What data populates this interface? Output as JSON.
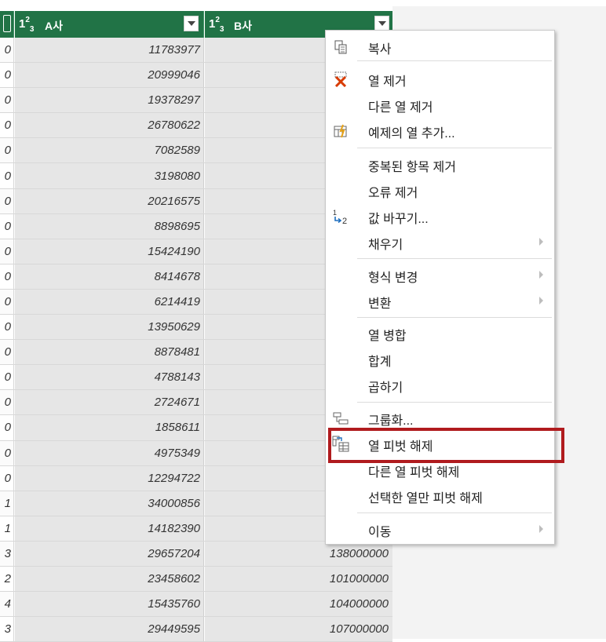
{
  "grid": {
    "columns": [
      {
        "type_label": "1²₃",
        "name": "A사"
      },
      {
        "type_label": "1²₃",
        "name": "B사"
      }
    ],
    "rows": [
      {
        "left": "0",
        "a": "11783977",
        "b": ""
      },
      {
        "left": "0",
        "a": "20999046",
        "b": ""
      },
      {
        "left": "0",
        "a": "19378297",
        "b": ""
      },
      {
        "left": "0",
        "a": "26780622",
        "b": ""
      },
      {
        "left": "0",
        "a": "7082589",
        "b": ""
      },
      {
        "left": "0",
        "a": "3198080",
        "b": ""
      },
      {
        "left": "0",
        "a": "20216575",
        "b": ""
      },
      {
        "left": "0",
        "a": "8898695",
        "b": ""
      },
      {
        "left": "0",
        "a": "15424190",
        "b": ""
      },
      {
        "left": "0",
        "a": "8414678",
        "b": ""
      },
      {
        "left": "0",
        "a": "6214419",
        "b": ""
      },
      {
        "left": "0",
        "a": "13950629",
        "b": ""
      },
      {
        "left": "0",
        "a": "8878481",
        "b": ""
      },
      {
        "left": "0",
        "a": "4788143",
        "b": ""
      },
      {
        "left": "0",
        "a": "2724671",
        "b": ""
      },
      {
        "left": "0",
        "a": "1858611",
        "b": ""
      },
      {
        "left": "0",
        "a": "4975349",
        "b": ""
      },
      {
        "left": "0",
        "a": "12294722",
        "b": ""
      },
      {
        "left": "1",
        "a": "34000856",
        "b": ""
      },
      {
        "left": "1",
        "a": "14182390",
        "b": ""
      },
      {
        "left": "3",
        "a": "29657204",
        "b": "138000000"
      },
      {
        "left": "2",
        "a": "23458602",
        "b": "101000000"
      },
      {
        "left": "4",
        "a": "15435760",
        "b": "104000000"
      },
      {
        "left": "3",
        "a": "29449595",
        "b": "107000000"
      }
    ]
  },
  "menu": {
    "items": [
      {
        "label": "복사",
        "icon": "copy-icon"
      },
      {
        "label": "열 제거",
        "icon": "remove-column-icon"
      },
      {
        "label": "다른 열 제거",
        "icon": ""
      },
      {
        "label": "예제의 열 추가...",
        "icon": "column-from-examples-icon"
      },
      {
        "label": "중복된 항목 제거",
        "icon": ""
      },
      {
        "label": "오류 제거",
        "icon": ""
      },
      {
        "label": "값 바꾸기...",
        "icon": "replace-values-icon"
      },
      {
        "label": "채우기",
        "icon": ""
      },
      {
        "label": "형식 변경",
        "icon": ""
      },
      {
        "label": "변환",
        "icon": ""
      },
      {
        "label": "열 병합",
        "icon": ""
      },
      {
        "label": "합계",
        "icon": ""
      },
      {
        "label": "곱하기",
        "icon": ""
      },
      {
        "label": "그룹화...",
        "icon": "group-by-icon"
      },
      {
        "label": "열 피벗 해제",
        "icon": "unpivot-icon"
      },
      {
        "label": "다른 열 피벗 해제",
        "icon": ""
      },
      {
        "label": "선택한 열만 피벗 해제",
        "icon": ""
      },
      {
        "label": "이동",
        "icon": ""
      }
    ]
  },
  "colors": {
    "header_green": "#217346",
    "highlight_red": "#b01b1e",
    "column_gray": "#e6e6e6"
  }
}
